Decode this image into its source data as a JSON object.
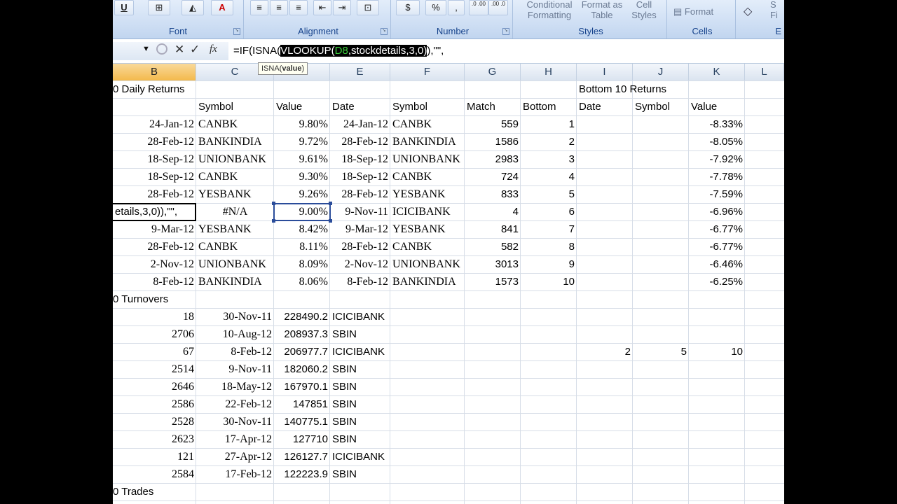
{
  "ribbon": {
    "font_label": "Font",
    "alignment_label": "Alignment",
    "number_label": "Number",
    "styles_label": "Styles",
    "cells_label": "Cells",
    "editing_label": "E",
    "underline_label": "U",
    "currency_label": "$",
    "percent_label": "%",
    "comma_label": ",",
    "increase_decimal_label": ".0 .00",
    "decrease_decimal_label": ".00 .0",
    "conditional_formatting_label": "Conditional Formatting",
    "format_as_table_label": "Format as Table",
    "cell_styles_label": "Cell Styles",
    "format_label": "Format",
    "sort_filter_label": "S Fi"
  },
  "formula_bar": {
    "prefix": "=IF(ISNA(",
    "highlight_func": "VLOOKUP(",
    "highlight_ref": "D8",
    "highlight_rest": ",stockdetails,3,0)",
    "suffix": "),\"\",",
    "fx_label": "fx",
    "tooltip_func": "ISNA(",
    "tooltip_arg": "value",
    "tooltip_close": ")"
  },
  "columns": [
    "B",
    "C",
    "D",
    "E",
    "F",
    "G",
    "H",
    "I",
    "J",
    "K",
    "L"
  ],
  "rows": [
    {
      "b": "0 Daily Returns",
      "c": "",
      "d": "",
      "e": "",
      "f": "",
      "g": "",
      "h": "",
      "i": "Bottom 10 Returns",
      "j": "",
      "k": ""
    },
    {
      "b": "",
      "c": "Symbol",
      "d": "Value",
      "e": "Date",
      "f": "Symbol",
      "g": "Match",
      "h": "Bottom",
      "i": "Date",
      "j": "Symbol",
      "k": "Value"
    },
    {
      "b": "24-Jan-12",
      "c": "CANBK",
      "d": "9.80%",
      "e": "24-Jan-12",
      "f": "CANBK",
      "g": "559",
      "h": "1",
      "i": "",
      "j": "",
      "k": "-8.33%"
    },
    {
      "b": "28-Feb-12",
      "c": "BANKINDIA",
      "d": "9.72%",
      "e": "28-Feb-12",
      "f": "BANKINDIA",
      "g": "1586",
      "h": "2",
      "i": "",
      "j": "",
      "k": "-8.05%"
    },
    {
      "b": "18-Sep-12",
      "c": "UNIONBANK",
      "d": "9.61%",
      "e": "18-Sep-12",
      "f": "UNIONBANK",
      "g": "2983",
      "h": "3",
      "i": "",
      "j": "",
      "k": "-7.92%"
    },
    {
      "b": "18-Sep-12",
      "c": "CANBK",
      "d": "9.30%",
      "e": "18-Sep-12",
      "f": "CANBK",
      "g": "724",
      "h": "4",
      "i": "",
      "j": "",
      "k": "-7.78%"
    },
    {
      "b": "28-Feb-12",
      "c": "YESBANK",
      "d": "9.26%",
      "e": "28-Feb-12",
      "f": "YESBANK",
      "g": "833",
      "h": "5",
      "i": "",
      "j": "",
      "k": "-7.59%"
    },
    {
      "b": "etails,3,0)),\"\",",
      "c": "#N/A",
      "d": "9.00%",
      "e": "9-Nov-11",
      "f": "ICICIBANK",
      "g": "4",
      "h": "6",
      "i": "",
      "j": "",
      "k": "-6.96%"
    },
    {
      "b": "9-Mar-12",
      "c": "YESBANK",
      "d": "8.42%",
      "e": "9-Mar-12",
      "f": "YESBANK",
      "g": "841",
      "h": "7",
      "i": "",
      "j": "",
      "k": "-6.77%"
    },
    {
      "b": "28-Feb-12",
      "c": "CANBK",
      "d": "8.11%",
      "e": "28-Feb-12",
      "f": "CANBK",
      "g": "582",
      "h": "8",
      "i": "",
      "j": "",
      "k": "-6.77%"
    },
    {
      "b": "2-Nov-12",
      "c": "UNIONBANK",
      "d": "8.09%",
      "e": "2-Nov-12",
      "f": "UNIONBANK",
      "g": "3013",
      "h": "9",
      "i": "",
      "j": "",
      "k": "-6.46%"
    },
    {
      "b": "8-Feb-12",
      "c": "BANKINDIA",
      "d": "8.06%",
      "e": "8-Feb-12",
      "f": "BANKINDIA",
      "g": "1573",
      "h": "10",
      "i": "",
      "j": "",
      "k": "-6.25%"
    },
    {
      "b": "0 Turnovers",
      "c": "",
      "d": "",
      "e": "",
      "f": "",
      "g": "",
      "h": "",
      "i": "",
      "j": "",
      "k": ""
    },
    {
      "b": "18",
      "c": "30-Nov-11",
      "d": "228490.2",
      "e": "ICICIBANK",
      "f": "",
      "g": "",
      "h": "",
      "i": "",
      "j": "",
      "k": ""
    },
    {
      "b": "2706",
      "c": "10-Aug-12",
      "d": "208937.3",
      "e": "SBIN",
      "f": "",
      "g": "",
      "h": "",
      "i": "",
      "j": "",
      "k": ""
    },
    {
      "b": "67",
      "c": "8-Feb-12",
      "d": "206977.7",
      "e": "ICICIBANK",
      "f": "",
      "g": "",
      "h": "",
      "i": "2",
      "j": "5",
      "k": "10"
    },
    {
      "b": "2514",
      "c": "9-Nov-11",
      "d": "182060.2",
      "e": "SBIN",
      "f": "",
      "g": "",
      "h": "",
      "i": "",
      "j": "",
      "k": ""
    },
    {
      "b": "2646",
      "c": "18-May-12",
      "d": "167970.1",
      "e": "SBIN",
      "f": "",
      "g": "",
      "h": "",
      "i": "",
      "j": "",
      "k": ""
    },
    {
      "b": "2586",
      "c": "22-Feb-12",
      "d": "147851",
      "e": "SBIN",
      "f": "",
      "g": "",
      "h": "",
      "i": "",
      "j": "",
      "k": ""
    },
    {
      "b": "2528",
      "c": "30-Nov-11",
      "d": "140775.1",
      "e": "SBIN",
      "f": "",
      "g": "",
      "h": "",
      "i": "",
      "j": "",
      "k": ""
    },
    {
      "b": "2623",
      "c": "17-Apr-12",
      "d": "127710",
      "e": "SBIN",
      "f": "",
      "g": "",
      "h": "",
      "i": "",
      "j": "",
      "k": ""
    },
    {
      "b": "121",
      "c": "27-Apr-12",
      "d": "126127.7",
      "e": "ICICIBANK",
      "f": "",
      "g": "",
      "h": "",
      "i": "",
      "j": "",
      "k": ""
    },
    {
      "b": "2584",
      "c": "17-Feb-12",
      "d": "122223.9",
      "e": "SBIN",
      "f": "",
      "g": "",
      "h": "",
      "i": "",
      "j": "",
      "k": ""
    },
    {
      "b": "0 Trades",
      "c": "",
      "d": "",
      "e": "",
      "f": "",
      "g": "",
      "h": "",
      "i": "",
      "j": "",
      "k": ""
    }
  ],
  "colors": {
    "ribbon_label": "#15428b",
    "selected_header": "#f3b94c",
    "formula_highlight_bg": "#000000",
    "formula_ref": "#3ccf3c"
  }
}
